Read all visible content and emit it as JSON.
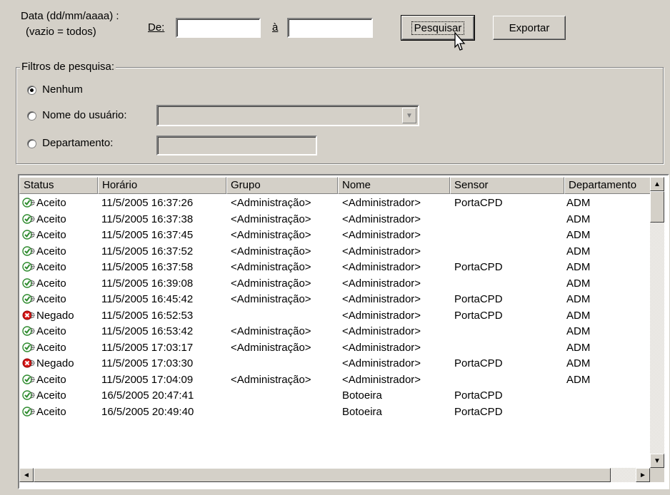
{
  "date_filter": {
    "label_line1": "Data (dd/mm/aaaa) :",
    "label_line2": "(vazio = todos)",
    "from_label": "De:",
    "to_label": "à",
    "from_value": "",
    "to_value": ""
  },
  "buttons": {
    "search": "Pesquisar",
    "export": "Exportar"
  },
  "filters": {
    "title": "Filtros de pesquisa:",
    "none": "Nenhum",
    "user": "Nome do usuário:",
    "department": "Departamento:",
    "selected": "none",
    "user_value": "",
    "department_value": ""
  },
  "table": {
    "columns": [
      "Status",
      "Horário",
      "Grupo",
      "Nome",
      "Sensor",
      "Departamento"
    ],
    "rows": [
      [
        "Aceito",
        "11/5/2005 16:37:26",
        "<Administração>",
        "<Administrador>",
        "PortaCPD",
        "ADM"
      ],
      [
        "Aceito",
        "11/5/2005 16:37:38",
        "<Administração>",
        "<Administrador>",
        "",
        "ADM"
      ],
      [
        "Aceito",
        "11/5/2005 16:37:45",
        "<Administração>",
        "<Administrador>",
        "",
        "ADM"
      ],
      [
        "Aceito",
        "11/5/2005 16:37:52",
        "<Administração>",
        "<Administrador>",
        "",
        "ADM"
      ],
      [
        "Aceito",
        "11/5/2005 16:37:58",
        "<Administração>",
        "<Administrador>",
        "PortaCPD",
        "ADM"
      ],
      [
        "Aceito",
        "11/5/2005 16:39:08",
        "<Administração>",
        "<Administrador>",
        "",
        "ADM"
      ],
      [
        "Aceito",
        "11/5/2005 16:45:42",
        "<Administração>",
        "<Administrador>",
        "PortaCPD",
        "ADM"
      ],
      [
        "Negado",
        "11/5/2005 16:52:53",
        "",
        "<Administrador>",
        "PortaCPD",
        "ADM"
      ],
      [
        "Aceito",
        "11/5/2005 16:53:42",
        "<Administração>",
        "<Administrador>",
        "",
        "ADM"
      ],
      [
        "Aceito",
        "11/5/2005 17:03:17",
        "<Administração>",
        "<Administrador>",
        "",
        "ADM"
      ],
      [
        "Negado",
        "11/5/2005 17:03:30",
        "",
        "<Administrador>",
        "PortaCPD",
        "ADM"
      ],
      [
        "Aceito",
        "11/5/2005 17:04:09",
        "<Administração>",
        "<Administrador>",
        "",
        "ADM"
      ],
      [
        "Aceito",
        "16/5/2005 20:47:41",
        "",
        "Botoeira",
        "PortaCPD",
        ""
      ],
      [
        "Aceito",
        "16/5/2005 20:49:40",
        "",
        "Botoeira",
        "PortaCPD",
        ""
      ]
    ]
  },
  "colors": {
    "accepted": "#2e8b2e",
    "denied": "#d81818"
  },
  "icons": {
    "accepted": "check-icon",
    "denied": "x-icon",
    "cursor": "mouse-pointer-icon"
  }
}
